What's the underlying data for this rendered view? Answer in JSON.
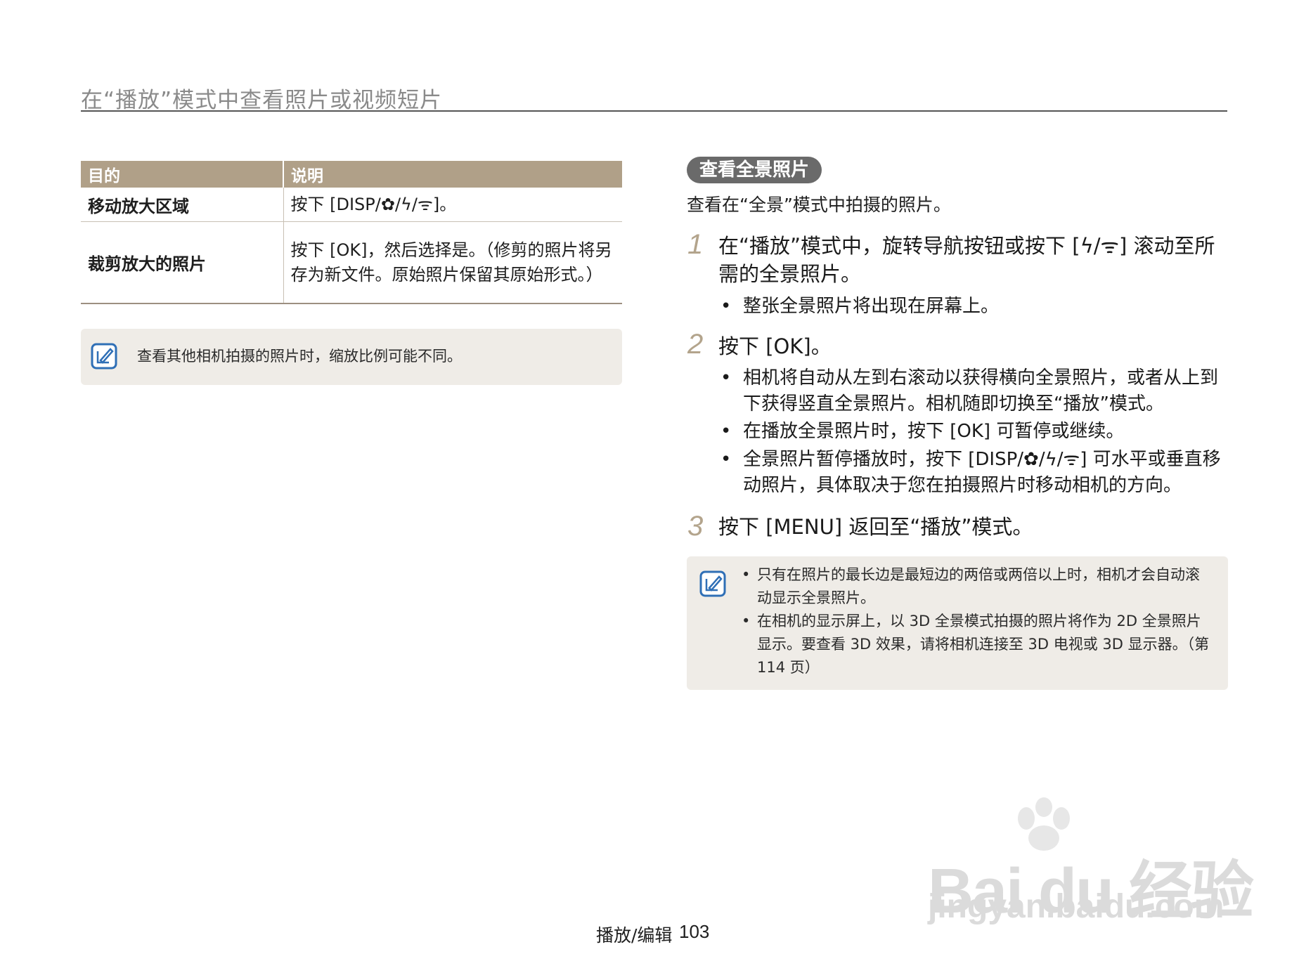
{
  "header": {
    "title": "在“播放”模式中查看照片或视频短片"
  },
  "table": {
    "headers": [
      "目的",
      "说明"
    ],
    "rows": [
      {
        "purpose": "移动放大区域",
        "desc": "按下 [DISP/✿/ϟ/ᯤ]。"
      },
      {
        "purpose": "裁剪放大的照片",
        "desc": "按下 [OK]，然后选择是。（修剪的照片将另存为新文件。原始照片保留其原始形式。）"
      }
    ]
  },
  "note_left": {
    "text": "查看其他相机拍摄的照片时，缩放比例可能不同。"
  },
  "section": {
    "title": "查看全景照片",
    "intro": "查看在“全景”模式中拍摄的照片。",
    "steps": [
      {
        "num": "1",
        "text": "在“播放”模式中，旋转导航按钮或按下 [ϟ/ᯤ] 滚动至所需的全景照片。",
        "bullets": [
          "整张全景照片将出现在屏幕上。"
        ]
      },
      {
        "num": "2",
        "text": "按下 [OK]。",
        "bullets": [
          "相机将自动从左到右滚动以获得横向全景照片，或者从上到下获得竖直全景照片。相机随即切换至“播放”模式。",
          "在播放全景照片时，按下 [OK] 可暂停或继续。",
          "全景照片暂停播放时，按下 [DISP/✿/ϟ/ᯤ] 可水平或垂直移动照片，具体取决于您在拍摄照片时移动相机的方向。"
        ]
      },
      {
        "num": "3",
        "text": "按下 [MENU] 返回至“播放”模式。",
        "bullets": []
      }
    ]
  },
  "note_right": {
    "bullets": [
      "只有在照片的最长边是最短边的两倍或两倍以上时，相机才会自动滚动显示全景照片。",
      "在相机的显示屏上，以 3D 全景模式拍摄的照片将作为 2D 全景照片显示。要查看 3D 效果，请将相机连接至 3D 电视或 3D 显示器。（第 114 页）"
    ]
  },
  "footer": {
    "section": "播放/编辑",
    "page": "103"
  },
  "watermark": {
    "brand": "Bai du 经验",
    "sub": "jingyan.baidu.com"
  },
  "colors": {
    "table_header": "#b0a088",
    "note_bg": "#efece7",
    "step_number": "#b3a48c",
    "pill": "#6a6a6a",
    "note_icon": "#2f6fb6"
  }
}
